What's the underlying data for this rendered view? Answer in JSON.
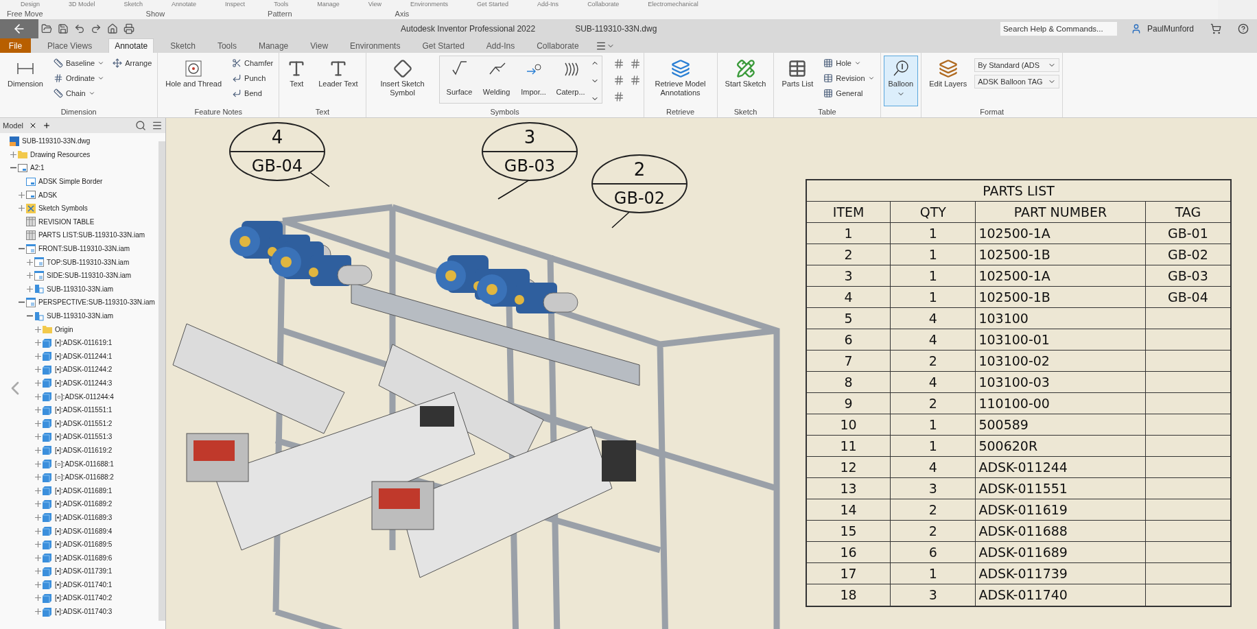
{
  "background_ribbon": {
    "tabs": [
      "Design",
      "3D Model",
      "Sketch",
      "Annotate",
      "Inspect",
      "Tools",
      "Manage",
      "View",
      "Environments",
      "Get Started",
      "Add-Ins",
      "Collaborate",
      "Electromechanical"
    ],
    "commands": [
      "Free Move",
      "Show",
      "Pattern",
      "Axis"
    ]
  },
  "title_bar": {
    "app_title": "Autodesk Inventor Professional 2022",
    "document": "SUB-119310-33N.dwg",
    "search_placeholder": "Search Help & Commands...",
    "user": "PaulMunford"
  },
  "tabs": [
    {
      "label": "File",
      "selected": false
    },
    {
      "label": "Place Views",
      "selected": false
    },
    {
      "label": "Annotate",
      "selected": true
    },
    {
      "label": "Sketch",
      "selected": false
    },
    {
      "label": "Tools",
      "selected": false
    },
    {
      "label": "Manage",
      "selected": false
    },
    {
      "label": "View",
      "selected": false
    },
    {
      "label": "Environments",
      "selected": false
    },
    {
      "label": "Get Started",
      "selected": false
    },
    {
      "label": "Add-Ins",
      "selected": false
    },
    {
      "label": "Collaborate",
      "selected": false
    }
  ],
  "ribbon": [
    {
      "label": "Dimension",
      "items": [
        {
          "kind": "large",
          "label": "Dimension",
          "selected": false
        },
        {
          "kind": "small",
          "label": "Baseline",
          "menu": true
        },
        {
          "kind": "small",
          "label": "Ordinate",
          "menu": true
        },
        {
          "kind": "small",
          "label": "Chain",
          "menu": true
        },
        {
          "kind": "small",
          "label": "Arrange",
          "menu": false
        }
      ]
    },
    {
      "label": "Feature Notes",
      "items": [
        {
          "kind": "large",
          "label": "Hole and Thread",
          "selected": false
        },
        {
          "kind": "small",
          "label": "Chamfer",
          "menu": false
        },
        {
          "kind": "small",
          "label": "Punch",
          "menu": false
        },
        {
          "kind": "small",
          "label": "Bend",
          "menu": false
        }
      ]
    },
    {
      "label": "Text",
      "items": [
        {
          "kind": "large",
          "label": "Text",
          "selected": false
        },
        {
          "kind": "large",
          "label": "Leader Text",
          "selected": false
        }
      ]
    },
    {
      "label": "Symbols",
      "items": [
        {
          "kind": "large",
          "label": "Insert Sketch Symbol",
          "selected": false
        },
        {
          "kind": "gallery",
          "label": "Surface"
        },
        {
          "kind": "gallery",
          "label": "Welding"
        },
        {
          "kind": "gallery",
          "label": "Impor..."
        },
        {
          "kind": "gallery",
          "label": "Caterp..."
        },
        {
          "kind": "iconset"
        }
      ]
    },
    {
      "label": "Retrieve",
      "items": [
        {
          "kind": "large",
          "label": "Retrieve Model Annotations",
          "selected": false
        }
      ]
    },
    {
      "label": "Sketch",
      "items": [
        {
          "kind": "large",
          "label": "Start Sketch",
          "selected": false
        }
      ]
    },
    {
      "label": "Table",
      "items": [
        {
          "kind": "large",
          "label": "Parts List",
          "selected": false
        },
        {
          "kind": "small",
          "label": "Hole",
          "menu": true
        },
        {
          "kind": "small",
          "label": "Revision",
          "menu": true
        },
        {
          "kind": "small",
          "label": "General",
          "menu": false
        }
      ]
    },
    {
      "items": [
        {
          "kind": "large",
          "label": "Balloon",
          "selected": true,
          "menu": true
        }
      ]
    },
    {
      "label": "Format",
      "items": [
        {
          "kind": "large",
          "label": "Edit Layers",
          "selected": false
        },
        {
          "kind": "dropdown",
          "label": "By Standard (ADS"
        },
        {
          "kind": "dropdown",
          "label": "ADSK Balloon TAG"
        }
      ]
    }
  ],
  "browser": {
    "tab": "Model",
    "tree": [
      {
        "label": "SUB-119310-33N.dwg",
        "kind": "drawing",
        "children": [
          {
            "label": "Drawing Resources",
            "kind": "folder",
            "expanded": false
          },
          {
            "label": "A2:1",
            "kind": "sheet",
            "expanded": true,
            "children": [
              {
                "label": "ADSK Simple Border",
                "kind": "border"
              },
              {
                "label": "ADSK",
                "kind": "sheet",
                "expanded": false
              },
              {
                "label": "Sketch Symbols",
                "kind": "symbols",
                "expanded": false
              },
              {
                "label": "REVISION TABLE",
                "kind": "table"
              },
              {
                "label": "PARTS LIST:SUB-119310-33N.iam",
                "kind": "table"
              },
              {
                "label": "FRONT:SUB-119310-33N.iam",
                "kind": "view",
                "expanded": true,
                "children": [
                  {
                    "label": "TOP:SUB-119310-33N.iam",
                    "kind": "view",
                    "expanded": false
                  },
                  {
                    "label": "SIDE:SUB-119310-33N.iam",
                    "kind": "view",
                    "expanded": false
                  },
                  {
                    "label": "SUB-119310-33N.iam",
                    "kind": "assembly",
                    "expanded": false
                  }
                ]
              },
              {
                "label": "PERSPECTIVE:SUB-119310-33N.iam",
                "kind": "view",
                "expanded": true,
                "children": [
                  {
                    "label": "SUB-119310-33N.iam",
                    "kind": "assembly",
                    "expanded": true,
                    "children": [
                      {
                        "label": "Origin",
                        "kind": "folder",
                        "expanded": false
                      },
                      {
                        "label": "[•]:ADSK-011619:1",
                        "kind": "part",
                        "expanded": false
                      },
                      {
                        "label": "[•]:ADSK-011244:1",
                        "kind": "part",
                        "expanded": false
                      },
                      {
                        "label": "[•]:ADSK-011244:2",
                        "kind": "part",
                        "expanded": false
                      },
                      {
                        "label": "[•]:ADSK-011244:3",
                        "kind": "part",
                        "expanded": false
                      },
                      {
                        "label": "[○]:ADSK-011244:4",
                        "kind": "part",
                        "expanded": false
                      },
                      {
                        "label": "[•]:ADSK-011551:1",
                        "kind": "part",
                        "expanded": false
                      },
                      {
                        "label": "[•]:ADSK-011551:2",
                        "kind": "part",
                        "expanded": false
                      },
                      {
                        "label": "[•]:ADSK-011551:3",
                        "kind": "part",
                        "expanded": false
                      },
                      {
                        "label": "[•]:ADSK-011619:2",
                        "kind": "part",
                        "expanded": false
                      },
                      {
                        "label": "[○]:ADSK-011688:1",
                        "kind": "part",
                        "expanded": false
                      },
                      {
                        "label": "[○]:ADSK-011688:2",
                        "kind": "part",
                        "expanded": false
                      },
                      {
                        "label": "[•]:ADSK-011689:1",
                        "kind": "part",
                        "expanded": false
                      },
                      {
                        "label": "[•]:ADSK-011689:2",
                        "kind": "part",
                        "expanded": false
                      },
                      {
                        "label": "[•]:ADSK-011689:3",
                        "kind": "part",
                        "expanded": false
                      },
                      {
                        "label": "[•]:ADSK-011689:4",
                        "kind": "part",
                        "expanded": false
                      },
                      {
                        "label": "[•]:ADSK-011689:5",
                        "kind": "part",
                        "expanded": false
                      },
                      {
                        "label": "[•]:ADSK-011689:6",
                        "kind": "part",
                        "expanded": false
                      },
                      {
                        "label": "[•]:ADSK-011739:1",
                        "kind": "part",
                        "expanded": false
                      },
                      {
                        "label": "[•]:ADSK-011740:1",
                        "kind": "part",
                        "expanded": false
                      },
                      {
                        "label": "[•]:ADSK-011740:2",
                        "kind": "part",
                        "expanded": false
                      },
                      {
                        "label": "[•]:ADSK-011740:3",
                        "kind": "part",
                        "expanded": false
                      }
                    ]
                  }
                ]
              }
            ]
          }
        ]
      }
    ]
  },
  "balloons": [
    {
      "number": "4",
      "tag": "GB-04"
    },
    {
      "number": "3",
      "tag": "GB-03"
    },
    {
      "number": "2",
      "tag": "GB-02"
    }
  ],
  "parts_list": {
    "title": "PARTS LIST",
    "columns": [
      "ITEM",
      "QTY",
      "PART NUMBER",
      "TAG"
    ],
    "rows": [
      [
        "1",
        "1",
        "102500-1A",
        "GB-01"
      ],
      [
        "2",
        "1",
        "102500-1B",
        "GB-02"
      ],
      [
        "3",
        "1",
        "102500-1A",
        "GB-03"
      ],
      [
        "4",
        "1",
        "102500-1B",
        "GB-04"
      ],
      [
        "5",
        "4",
        "103100",
        ""
      ],
      [
        "6",
        "4",
        "103100-01",
        ""
      ],
      [
        "7",
        "2",
        "103100-02",
        ""
      ],
      [
        "8",
        "4",
        "103100-03",
        ""
      ],
      [
        "9",
        "2",
        "110100-00",
        ""
      ],
      [
        "10",
        "1",
        "500589",
        ""
      ],
      [
        "11",
        "1",
        "500620R",
        ""
      ],
      [
        "12",
        "4",
        "ADSK-011244",
        ""
      ],
      [
        "13",
        "3",
        "ADSK-011551",
        ""
      ],
      [
        "14",
        "2",
        "ADSK-011619",
        ""
      ],
      [
        "15",
        "2",
        "ADSK-011688",
        ""
      ],
      [
        "16",
        "6",
        "ADSK-011689",
        ""
      ],
      [
        "17",
        "1",
        "ADSK-011739",
        ""
      ],
      [
        "18",
        "3",
        "ADSK-011740",
        ""
      ]
    ]
  }
}
